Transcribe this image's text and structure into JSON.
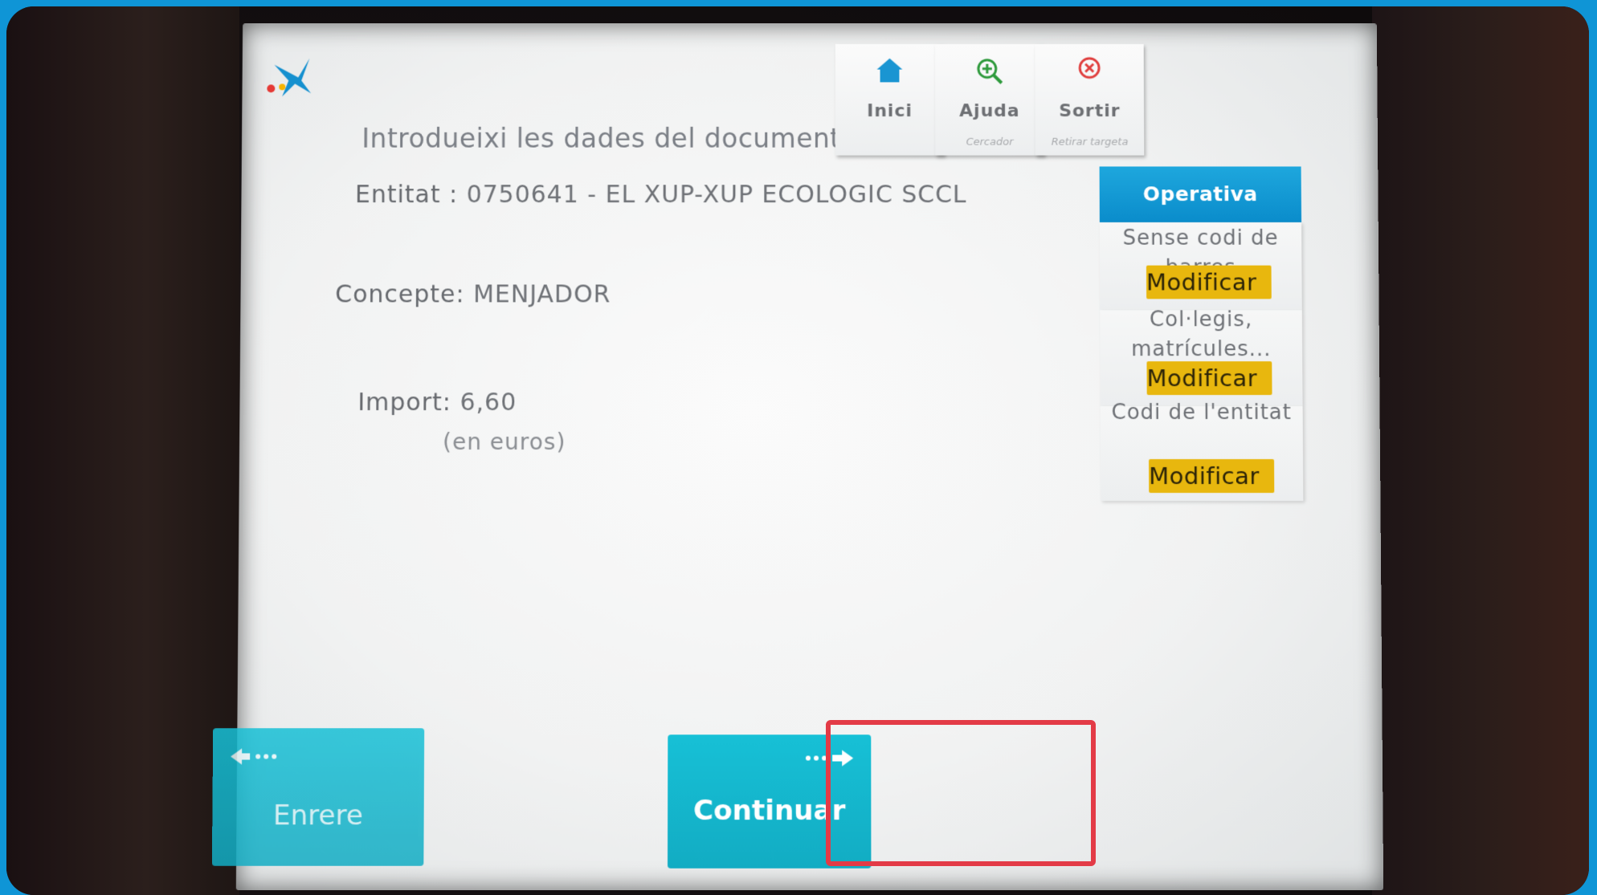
{
  "screen": {
    "title": "Introdueixi les dades del document"
  },
  "top_buttons": {
    "home": {
      "label": "Inici",
      "icon": "home-icon"
    },
    "help": {
      "label": "Ajuda",
      "sublabel": "Cercador",
      "icon": "magnifier-plus-icon"
    },
    "exit": {
      "label": "Sortir",
      "sublabel": "Retirar targeta",
      "icon": "close-circle-icon"
    }
  },
  "fields": {
    "entitat_label": "Entitat :",
    "entitat_value": "0750641 - EL XUP-XUP ECOLOGIC SCCL",
    "concepte_label": "Concepte:",
    "concepte_value": "MENJADOR",
    "import_label": "Import:",
    "import_value": "6,60",
    "import_unit": "(en euros)"
  },
  "sidebar": {
    "header": "Operativa",
    "items": [
      {
        "text": "Sense codi de barres",
        "button": "Modificar"
      },
      {
        "text": "Col·legis, matrícules...",
        "button": "Modificar"
      },
      {
        "text": "Codi de l'entitat",
        "button": "Modificar"
      }
    ]
  },
  "nav": {
    "back_label": "Enrere",
    "continue_label": "Continuar"
  },
  "colors": {
    "accent_blue": "#0a8ccb",
    "nav_cyan": "#14b6cd",
    "modify_yellow": "#e8b70e",
    "highlight_red": "#e33b47",
    "outer_border": "#0f95d6"
  }
}
